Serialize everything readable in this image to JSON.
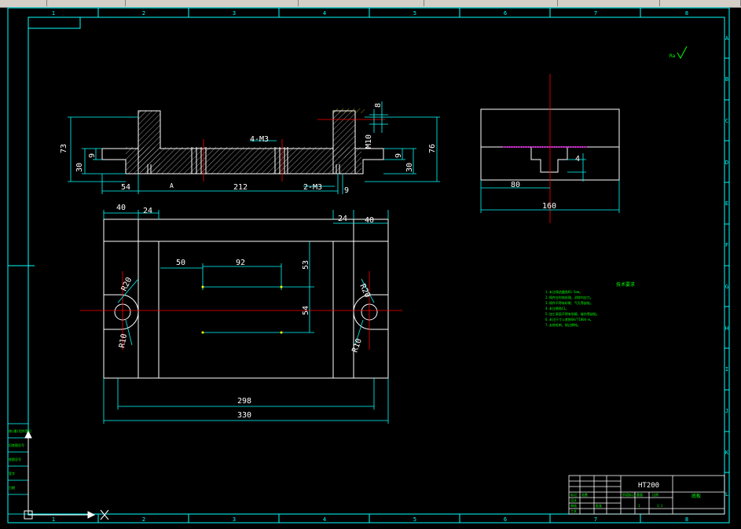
{
  "toolbar": {
    "cells": [
      "",
      "",
      "",
      "",
      "",
      "",
      ""
    ]
  },
  "border": {
    "columns": [
      "1",
      "2",
      "3",
      "4",
      "5",
      "6",
      "7",
      "8"
    ],
    "rows": [
      "A",
      "B",
      "C",
      "D",
      "E",
      "F",
      "G",
      "H",
      "I",
      "J",
      "K",
      "L"
    ]
  },
  "roughness_symbol": "Ra",
  "front_view": {
    "dims": {
      "h73": "73",
      "h30": "30",
      "h9": "9",
      "top8": "8",
      "m10": "M10",
      "thread_4m3": "4-M3",
      "h76": "76",
      "h9r": "9",
      "h30r": "30",
      "w54": "54",
      "w212": "212",
      "thread_2m3": "2-M3",
      "w9": "9",
      "tag": "A"
    }
  },
  "side_view": {
    "dims": {
      "d4": "4",
      "d80": "80",
      "d160": "160"
    }
  },
  "top_view": {
    "dims": {
      "w40l": "40",
      "w24l": "24",
      "w24r": "24",
      "w40r": "40",
      "w50": "50",
      "w92": "92",
      "h53": "53",
      "h54": "54",
      "r20l": "R20",
      "r10l": "R10",
      "r20r": "R20",
      "r10r": "R10",
      "w298": "298",
      "w330": "330"
    }
  },
  "notes": {
    "title": "技术要求",
    "lines": [
      "1.未注铸造圆角R3-5mm。",
      "2.铸件应时效处理，消除内应力。",
      "3.铸件不得有砂眼、气孔等缺陷。",
      "4.未注倒角C1。",
      "5.加工表面不得有划痕、碰伤等缺陷。",
      "6.未注尺寸公差按GB/T1804-m。",
      "7.去除毛刺，锐边倒钝。"
    ]
  },
  "title_block": {
    "material": "HT200",
    "part_name": "底板",
    "cells": [
      "标记",
      "处数",
      "设计",
      "审核",
      "工艺",
      "批准",
      "阶段标记",
      "重量",
      "比例",
      "1",
      "1:1"
    ]
  },
  "left_panel": {
    "items": [
      "借(通)用件登记",
      "旧底图总号",
      "底图总号",
      "签字",
      "日期"
    ]
  }
}
